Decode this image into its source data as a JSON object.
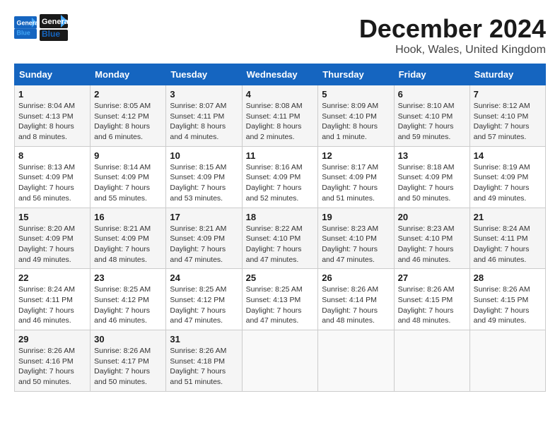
{
  "header": {
    "logo_line1": "General",
    "logo_line2": "Blue",
    "title": "December 2024",
    "subtitle": "Hook, Wales, United Kingdom"
  },
  "weekdays": [
    "Sunday",
    "Monday",
    "Tuesday",
    "Wednesday",
    "Thursday",
    "Friday",
    "Saturday"
  ],
  "weeks": [
    [
      {
        "day": "1",
        "sunrise": "8:04 AM",
        "sunset": "4:13 PM",
        "daylight": "8 hours and 8 minutes."
      },
      {
        "day": "2",
        "sunrise": "8:05 AM",
        "sunset": "4:12 PM",
        "daylight": "8 hours and 6 minutes."
      },
      {
        "day": "3",
        "sunrise": "8:07 AM",
        "sunset": "4:11 PM",
        "daylight": "8 hours and 4 minutes."
      },
      {
        "day": "4",
        "sunrise": "8:08 AM",
        "sunset": "4:11 PM",
        "daylight": "8 hours and 2 minutes."
      },
      {
        "day": "5",
        "sunrise": "8:09 AM",
        "sunset": "4:10 PM",
        "daylight": "8 hours and 1 minute."
      },
      {
        "day": "6",
        "sunrise": "8:10 AM",
        "sunset": "4:10 PM",
        "daylight": "7 hours and 59 minutes."
      },
      {
        "day": "7",
        "sunrise": "8:12 AM",
        "sunset": "4:10 PM",
        "daylight": "7 hours and 57 minutes."
      }
    ],
    [
      {
        "day": "8",
        "sunrise": "8:13 AM",
        "sunset": "4:09 PM",
        "daylight": "7 hours and 56 minutes."
      },
      {
        "day": "9",
        "sunrise": "8:14 AM",
        "sunset": "4:09 PM",
        "daylight": "7 hours and 55 minutes."
      },
      {
        "day": "10",
        "sunrise": "8:15 AM",
        "sunset": "4:09 PM",
        "daylight": "7 hours and 53 minutes."
      },
      {
        "day": "11",
        "sunrise": "8:16 AM",
        "sunset": "4:09 PM",
        "daylight": "7 hours and 52 minutes."
      },
      {
        "day": "12",
        "sunrise": "8:17 AM",
        "sunset": "4:09 PM",
        "daylight": "7 hours and 51 minutes."
      },
      {
        "day": "13",
        "sunrise": "8:18 AM",
        "sunset": "4:09 PM",
        "daylight": "7 hours and 50 minutes."
      },
      {
        "day": "14",
        "sunrise": "8:19 AM",
        "sunset": "4:09 PM",
        "daylight": "7 hours and 49 minutes."
      }
    ],
    [
      {
        "day": "15",
        "sunrise": "8:20 AM",
        "sunset": "4:09 PM",
        "daylight": "7 hours and 49 minutes."
      },
      {
        "day": "16",
        "sunrise": "8:21 AM",
        "sunset": "4:09 PM",
        "daylight": "7 hours and 48 minutes."
      },
      {
        "day": "17",
        "sunrise": "8:21 AM",
        "sunset": "4:09 PM",
        "daylight": "7 hours and 47 minutes."
      },
      {
        "day": "18",
        "sunrise": "8:22 AM",
        "sunset": "4:10 PM",
        "daylight": "7 hours and 47 minutes."
      },
      {
        "day": "19",
        "sunrise": "8:23 AM",
        "sunset": "4:10 PM",
        "daylight": "7 hours and 47 minutes."
      },
      {
        "day": "20",
        "sunrise": "8:23 AM",
        "sunset": "4:10 PM",
        "daylight": "7 hours and 46 minutes."
      },
      {
        "day": "21",
        "sunrise": "8:24 AM",
        "sunset": "4:11 PM",
        "daylight": "7 hours and 46 minutes."
      }
    ],
    [
      {
        "day": "22",
        "sunrise": "8:24 AM",
        "sunset": "4:11 PM",
        "daylight": "7 hours and 46 minutes."
      },
      {
        "day": "23",
        "sunrise": "8:25 AM",
        "sunset": "4:12 PM",
        "daylight": "7 hours and 46 minutes."
      },
      {
        "day": "24",
        "sunrise": "8:25 AM",
        "sunset": "4:12 PM",
        "daylight": "7 hours and 47 minutes."
      },
      {
        "day": "25",
        "sunrise": "8:25 AM",
        "sunset": "4:13 PM",
        "daylight": "7 hours and 47 minutes."
      },
      {
        "day": "26",
        "sunrise": "8:26 AM",
        "sunset": "4:14 PM",
        "daylight": "7 hours and 48 minutes."
      },
      {
        "day": "27",
        "sunrise": "8:26 AM",
        "sunset": "4:15 PM",
        "daylight": "7 hours and 48 minutes."
      },
      {
        "day": "28",
        "sunrise": "8:26 AM",
        "sunset": "4:15 PM",
        "daylight": "7 hours and 49 minutes."
      }
    ],
    [
      {
        "day": "29",
        "sunrise": "8:26 AM",
        "sunset": "4:16 PM",
        "daylight": "7 hours and 50 minutes."
      },
      {
        "day": "30",
        "sunrise": "8:26 AM",
        "sunset": "4:17 PM",
        "daylight": "7 hours and 50 minutes."
      },
      {
        "day": "31",
        "sunrise": "8:26 AM",
        "sunset": "4:18 PM",
        "daylight": "7 hours and 51 minutes."
      },
      null,
      null,
      null,
      null
    ]
  ],
  "labels": {
    "sunrise": "Sunrise:",
    "sunset": "Sunset:",
    "daylight": "Daylight:"
  }
}
